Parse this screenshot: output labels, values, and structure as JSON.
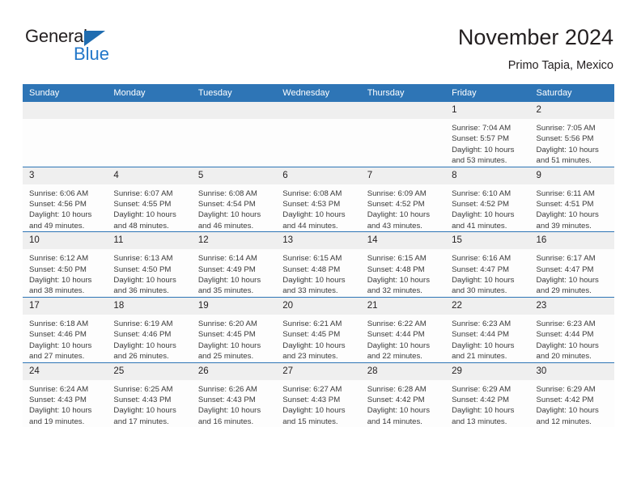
{
  "brand": {
    "name_top": "General",
    "name_bottom": "Blue"
  },
  "header": {
    "title": "November 2024",
    "subtitle": "Primo Tapia, Mexico"
  },
  "colors": {
    "header_blue": "#2E75B6",
    "daynum_band": "#EFEFEF",
    "logo_blue": "#2277C9",
    "text": "#231F20"
  },
  "labels": {
    "sunrise_prefix": "Sunrise:",
    "sunset_prefix": "Sunset:",
    "daylight_prefix": "Daylight:"
  },
  "weekdays": [
    "Sunday",
    "Monday",
    "Tuesday",
    "Wednesday",
    "Thursday",
    "Friday",
    "Saturday"
  ],
  "weeks": [
    [
      {
        "day": "",
        "empty": true,
        "sunrise": "",
        "sunset": "",
        "daylight1": "",
        "daylight2": ""
      },
      {
        "day": "",
        "empty": true,
        "sunrise": "",
        "sunset": "",
        "daylight1": "",
        "daylight2": ""
      },
      {
        "day": "",
        "empty": true,
        "sunrise": "",
        "sunset": "",
        "daylight1": "",
        "daylight2": ""
      },
      {
        "day": "",
        "empty": true,
        "sunrise": "",
        "sunset": "",
        "daylight1": "",
        "daylight2": ""
      },
      {
        "day": "",
        "empty": true,
        "sunrise": "",
        "sunset": "",
        "daylight1": "",
        "daylight2": ""
      },
      {
        "day": "1",
        "empty": false,
        "sunrise": "Sunrise: 7:04 AM",
        "sunset": "Sunset: 5:57 PM",
        "daylight1": "Daylight: 10 hours",
        "daylight2": "and 53 minutes."
      },
      {
        "day": "2",
        "empty": false,
        "sunrise": "Sunrise: 7:05 AM",
        "sunset": "Sunset: 5:56 PM",
        "daylight1": "Daylight: 10 hours",
        "daylight2": "and 51 minutes."
      }
    ],
    [
      {
        "day": "3",
        "empty": false,
        "sunrise": "Sunrise: 6:06 AM",
        "sunset": "Sunset: 4:56 PM",
        "daylight1": "Daylight: 10 hours",
        "daylight2": "and 49 minutes."
      },
      {
        "day": "4",
        "empty": false,
        "sunrise": "Sunrise: 6:07 AM",
        "sunset": "Sunset: 4:55 PM",
        "daylight1": "Daylight: 10 hours",
        "daylight2": "and 48 minutes."
      },
      {
        "day": "5",
        "empty": false,
        "sunrise": "Sunrise: 6:08 AM",
        "sunset": "Sunset: 4:54 PM",
        "daylight1": "Daylight: 10 hours",
        "daylight2": "and 46 minutes."
      },
      {
        "day": "6",
        "empty": false,
        "sunrise": "Sunrise: 6:08 AM",
        "sunset": "Sunset: 4:53 PM",
        "daylight1": "Daylight: 10 hours",
        "daylight2": "and 44 minutes."
      },
      {
        "day": "7",
        "empty": false,
        "sunrise": "Sunrise: 6:09 AM",
        "sunset": "Sunset: 4:52 PM",
        "daylight1": "Daylight: 10 hours",
        "daylight2": "and 43 minutes."
      },
      {
        "day": "8",
        "empty": false,
        "sunrise": "Sunrise: 6:10 AM",
        "sunset": "Sunset: 4:52 PM",
        "daylight1": "Daylight: 10 hours",
        "daylight2": "and 41 minutes."
      },
      {
        "day": "9",
        "empty": false,
        "sunrise": "Sunrise: 6:11 AM",
        "sunset": "Sunset: 4:51 PM",
        "daylight1": "Daylight: 10 hours",
        "daylight2": "and 39 minutes."
      }
    ],
    [
      {
        "day": "10",
        "empty": false,
        "sunrise": "Sunrise: 6:12 AM",
        "sunset": "Sunset: 4:50 PM",
        "daylight1": "Daylight: 10 hours",
        "daylight2": "and 38 minutes."
      },
      {
        "day": "11",
        "empty": false,
        "sunrise": "Sunrise: 6:13 AM",
        "sunset": "Sunset: 4:50 PM",
        "daylight1": "Daylight: 10 hours",
        "daylight2": "and 36 minutes."
      },
      {
        "day": "12",
        "empty": false,
        "sunrise": "Sunrise: 6:14 AM",
        "sunset": "Sunset: 4:49 PM",
        "daylight1": "Daylight: 10 hours",
        "daylight2": "and 35 minutes."
      },
      {
        "day": "13",
        "empty": false,
        "sunrise": "Sunrise: 6:15 AM",
        "sunset": "Sunset: 4:48 PM",
        "daylight1": "Daylight: 10 hours",
        "daylight2": "and 33 minutes."
      },
      {
        "day": "14",
        "empty": false,
        "sunrise": "Sunrise: 6:15 AM",
        "sunset": "Sunset: 4:48 PM",
        "daylight1": "Daylight: 10 hours",
        "daylight2": "and 32 minutes."
      },
      {
        "day": "15",
        "empty": false,
        "sunrise": "Sunrise: 6:16 AM",
        "sunset": "Sunset: 4:47 PM",
        "daylight1": "Daylight: 10 hours",
        "daylight2": "and 30 minutes."
      },
      {
        "day": "16",
        "empty": false,
        "sunrise": "Sunrise: 6:17 AM",
        "sunset": "Sunset: 4:47 PM",
        "daylight1": "Daylight: 10 hours",
        "daylight2": "and 29 minutes."
      }
    ],
    [
      {
        "day": "17",
        "empty": false,
        "sunrise": "Sunrise: 6:18 AM",
        "sunset": "Sunset: 4:46 PM",
        "daylight1": "Daylight: 10 hours",
        "daylight2": "and 27 minutes."
      },
      {
        "day": "18",
        "empty": false,
        "sunrise": "Sunrise: 6:19 AM",
        "sunset": "Sunset: 4:46 PM",
        "daylight1": "Daylight: 10 hours",
        "daylight2": "and 26 minutes."
      },
      {
        "day": "19",
        "empty": false,
        "sunrise": "Sunrise: 6:20 AM",
        "sunset": "Sunset: 4:45 PM",
        "daylight1": "Daylight: 10 hours",
        "daylight2": "and 25 minutes."
      },
      {
        "day": "20",
        "empty": false,
        "sunrise": "Sunrise: 6:21 AM",
        "sunset": "Sunset: 4:45 PM",
        "daylight1": "Daylight: 10 hours",
        "daylight2": "and 23 minutes."
      },
      {
        "day": "21",
        "empty": false,
        "sunrise": "Sunrise: 6:22 AM",
        "sunset": "Sunset: 4:44 PM",
        "daylight1": "Daylight: 10 hours",
        "daylight2": "and 22 minutes."
      },
      {
        "day": "22",
        "empty": false,
        "sunrise": "Sunrise: 6:23 AM",
        "sunset": "Sunset: 4:44 PM",
        "daylight1": "Daylight: 10 hours",
        "daylight2": "and 21 minutes."
      },
      {
        "day": "23",
        "empty": false,
        "sunrise": "Sunrise: 6:23 AM",
        "sunset": "Sunset: 4:44 PM",
        "daylight1": "Daylight: 10 hours",
        "daylight2": "and 20 minutes."
      }
    ],
    [
      {
        "day": "24",
        "empty": false,
        "sunrise": "Sunrise: 6:24 AM",
        "sunset": "Sunset: 4:43 PM",
        "daylight1": "Daylight: 10 hours",
        "daylight2": "and 19 minutes."
      },
      {
        "day": "25",
        "empty": false,
        "sunrise": "Sunrise: 6:25 AM",
        "sunset": "Sunset: 4:43 PM",
        "daylight1": "Daylight: 10 hours",
        "daylight2": "and 17 minutes."
      },
      {
        "day": "26",
        "empty": false,
        "sunrise": "Sunrise: 6:26 AM",
        "sunset": "Sunset: 4:43 PM",
        "daylight1": "Daylight: 10 hours",
        "daylight2": "and 16 minutes."
      },
      {
        "day": "27",
        "empty": false,
        "sunrise": "Sunrise: 6:27 AM",
        "sunset": "Sunset: 4:43 PM",
        "daylight1": "Daylight: 10 hours",
        "daylight2": "and 15 minutes."
      },
      {
        "day": "28",
        "empty": false,
        "sunrise": "Sunrise: 6:28 AM",
        "sunset": "Sunset: 4:42 PM",
        "daylight1": "Daylight: 10 hours",
        "daylight2": "and 14 minutes."
      },
      {
        "day": "29",
        "empty": false,
        "sunrise": "Sunrise: 6:29 AM",
        "sunset": "Sunset: 4:42 PM",
        "daylight1": "Daylight: 10 hours",
        "daylight2": "and 13 minutes."
      },
      {
        "day": "30",
        "empty": false,
        "sunrise": "Sunrise: 6:29 AM",
        "sunset": "Sunset: 4:42 PM",
        "daylight1": "Daylight: 10 hours",
        "daylight2": "and 12 minutes."
      }
    ]
  ]
}
